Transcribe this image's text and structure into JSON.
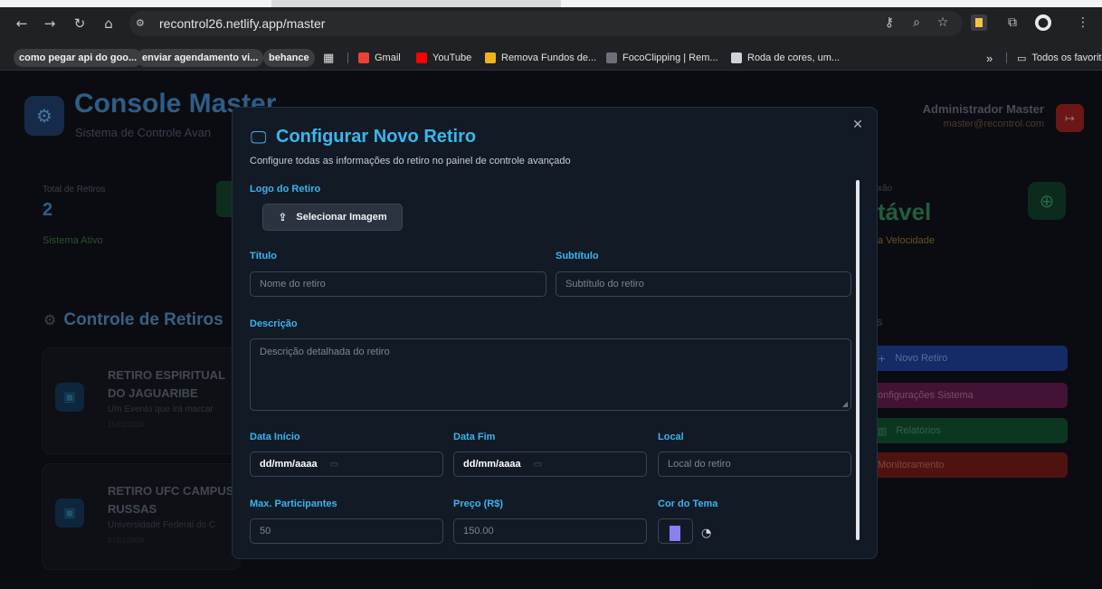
{
  "browser": {
    "url": "recontrol26.netlify.app/master",
    "bookmarks": [
      {
        "label": "como pegar api do goo...",
        "pill": true
      },
      {
        "label": "enviar agendamento vi...",
        "pill": true
      },
      {
        "label": "behance",
        "pill": true
      },
      {
        "label": "Gmail",
        "pill": false
      },
      {
        "label": "YouTube",
        "pill": false
      },
      {
        "label": "Remova Fundos de...",
        "pill": false
      },
      {
        "label": "FocoClipping | Rem...",
        "pill": false
      },
      {
        "label": "Roda de cores, um...",
        "pill": false
      }
    ],
    "more_label": "»",
    "all_favorites": "Todos os favoritos"
  },
  "background": {
    "brand": "Console Master",
    "brand_sub": "Sistema de Controle Avan",
    "admin_name": "Administrador Master",
    "admin_email": "master@recontrol.com",
    "stat_label": "Total de Retiros",
    "stat_value": "2",
    "stat_note": "Sistema Ativo",
    "stat2_label": "xão",
    "stat2_value": "tável",
    "stat2_note": "a Velocidade",
    "section_title": "Controle de Retiros",
    "cards": [
      {
        "title": "RETIRO ESPIRITUAL DO JAGUARIBE",
        "subtitle": "Um Evento que irá marcar",
        "meta": "15/01/2026"
      },
      {
        "title": "RETIRO UFC CAMPUS RUSSAS",
        "subtitle": "Universidade Federal do C",
        "meta": "07/01/2026"
      }
    ],
    "right_head": "s",
    "right_buttons": [
      {
        "label": "Novo Retiro",
        "color": "#1a3a8a",
        "text": "#7d90c8",
        "icon": "+"
      },
      {
        "label": "onfigurações Sistema",
        "color": "#5a1a48",
        "text": "#9b6a8a",
        "icon": ""
      },
      {
        "label": "Relatórios",
        "color": "#0f4a2c",
        "text": "#3e8260",
        "icon": "▥"
      },
      {
        "label": "Monitoramento",
        "color": "#6a1a14",
        "text": "#a06456",
        "icon": ""
      }
    ]
  },
  "modal": {
    "title": "Configurar Novo Retiro",
    "description": "Configure todas as informações do retiro no painel de controle avançado",
    "logo_label": "Logo do Retiro",
    "upload_label": "Selecionar Imagem",
    "title_label": "Título",
    "title_placeholder": "Nome do retiro",
    "subtitle_label": "Subtítulo",
    "subtitle_placeholder": "Subtítulo do retiro",
    "description_label": "Descrição",
    "description_placeholder": "Descrição detalhada do retiro",
    "start_label": "Data Início",
    "start_value": "dd/mm/aaaa",
    "end_label": "Data Fim",
    "end_value": "dd/mm/aaaa",
    "location_label": "Local",
    "location_placeholder": "Local do retiro",
    "max_label": "Max. Participantes",
    "max_value": "50",
    "price_label": "Preço (R$)",
    "price_value": "150.00",
    "theme_label": "Cor do Tema",
    "theme_color": "#8a80f0"
  }
}
